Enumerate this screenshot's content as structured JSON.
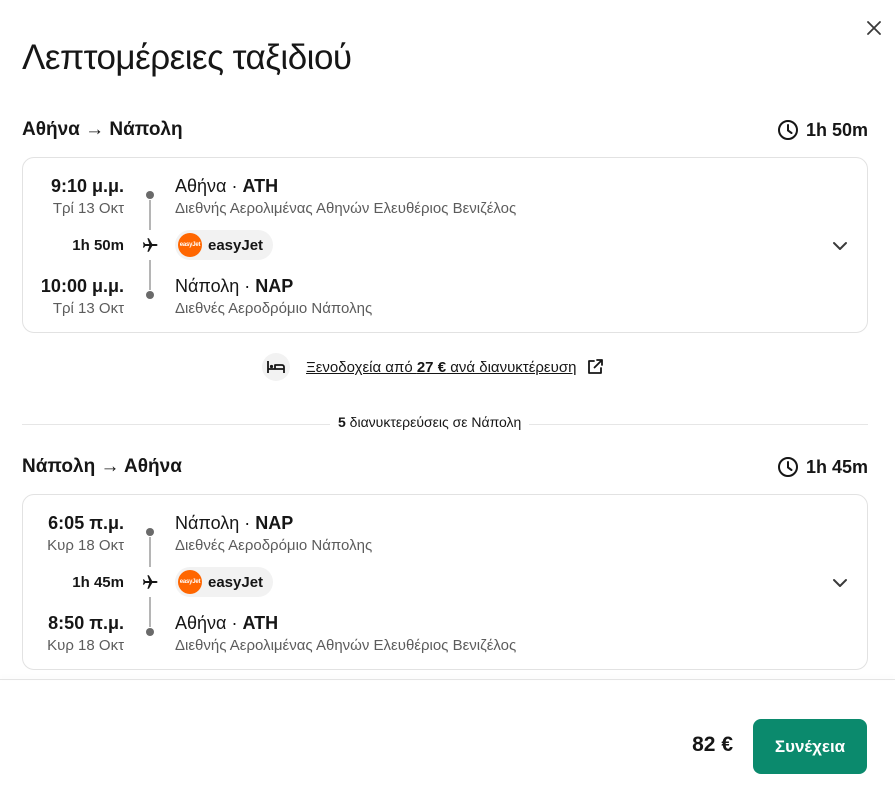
{
  "dialog": {
    "title": "Λεπτομέρειες ταξιδιού"
  },
  "legs": [
    {
      "route": "Αθήνα → Νάπολη",
      "duration": "1h 50m",
      "departure": {
        "time": "9:10 μ.μ.",
        "date": "Τρί 13 Οκτ",
        "city": "Αθήνα",
        "code": "ATH",
        "airport": "Διεθνής Αερολιμένας Αθηνών Ελευθέριος Βενιζέλος"
      },
      "segment_duration": "1h 50m",
      "airline": {
        "name": "easyJet",
        "logo_text": "easyJet",
        "color": "#ff6600"
      },
      "arrival": {
        "time": "10:00 μ.μ.",
        "date": "Τρί 13 Οκτ",
        "city": "Νάπολη",
        "code": "NAP",
        "airport": "Διεθνές Αεροδρόμιο Νάπολης"
      }
    },
    {
      "route": "Νάπολη → Αθήνα",
      "duration": "1h 45m",
      "departure": {
        "time": "6:05 π.μ.",
        "date": "Κυρ 18 Οκτ",
        "city": "Νάπολη",
        "code": "NAP",
        "airport": "Διεθνές Αεροδρόμιο Νάπολης"
      },
      "segment_duration": "1h 45m",
      "airline": {
        "name": "easyJet",
        "logo_text": "easyJet",
        "color": "#ff6600"
      },
      "arrival": {
        "time": "8:50 π.μ.",
        "date": "Κυρ 18 Οκτ",
        "city": "Αθήνα",
        "code": "ATH",
        "airport": "Διεθνής Αερολιμένας Αθηνών Ελευθέριος Βενιζέλος"
      }
    }
  ],
  "hotels": {
    "prefix": "Ξενοδοχεία από ",
    "price": "27 €",
    "suffix": " ανά διανυκτέρευση"
  },
  "stay": {
    "count": "5",
    "text": " διανυκτερεύσεις σε Νάπολη"
  },
  "footer": {
    "price": "82 €",
    "continue_label": "Συνέχεια"
  },
  "colors": {
    "accent": "#0b8a6d",
    "airline": "#ff6600"
  },
  "icons": [
    "close-icon",
    "clock-icon",
    "plane-icon",
    "chevron-down-icon",
    "bed-icon",
    "external-link-icon"
  ]
}
